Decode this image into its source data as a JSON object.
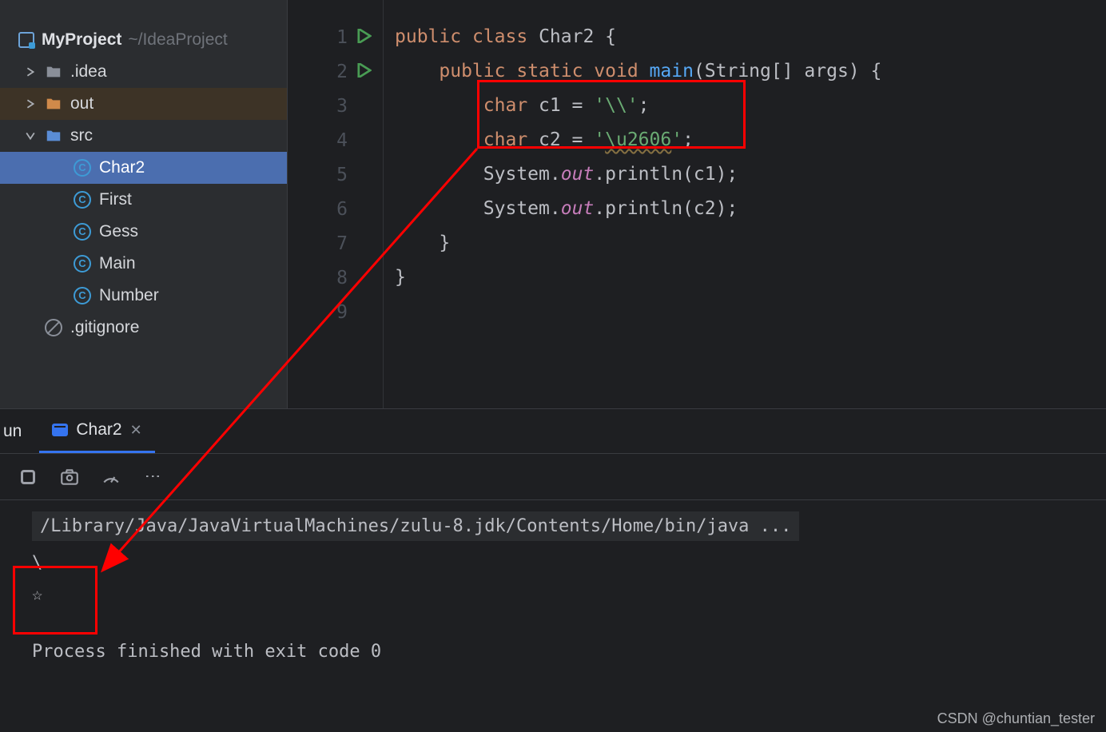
{
  "project": {
    "name": "MyProject",
    "path": "~/IdeaProject"
  },
  "tree": {
    "idea": ".idea",
    "out": "out",
    "src": "src",
    "files": {
      "char2": "Char2",
      "first": "First",
      "gess": "Gess",
      "main": "Main",
      "number": "Number"
    },
    "gitignore": ".gitignore"
  },
  "gutter": {
    "lines": [
      "1",
      "2",
      "3",
      "4",
      "5",
      "6",
      "7",
      "8",
      "9"
    ]
  },
  "code": {
    "l1a": "public",
    "l1b": "class",
    "l1c": "Char2",
    "l1d": " {",
    "l2a": "public",
    "l2b": "static",
    "l2c": "void",
    "l2d": "main",
    "l2e": "(String[] args) {",
    "l3a": "char",
    "l3b": " c1 = ",
    "l3c": "'\\\\'",
    "l3d": ";",
    "l4a": "char",
    "l4b": " c2 = ",
    "l4c": "'",
    "l4d": "\\u2606",
    "l4e": "'",
    "l4f": ";",
    "l5a": "System.",
    "l5b": "out",
    "l5c": ".println(c1);",
    "l6a": "System.",
    "l6b": "out",
    "l6c": ".println(c2);",
    "l7": "}",
    "l8": "}"
  },
  "run": {
    "tool": "un",
    "tab": "Char2",
    "close": "✕",
    "cmd": "/Library/Java/JavaVirtualMachines/zulu-8.jdk/Contents/Home/bin/java ...",
    "out1": "\\",
    "out2": "☆",
    "exit": "Process finished with exit code 0"
  },
  "watermark": "CSDN @chuntian_tester"
}
